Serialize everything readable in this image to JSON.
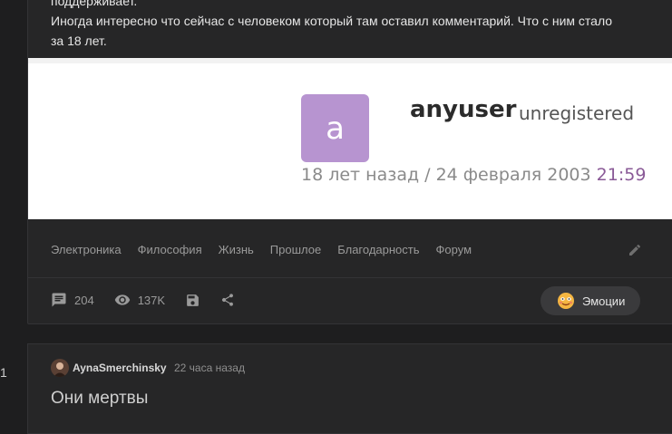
{
  "post": {
    "text_lines": [
      "поддерживает.",
      "Иногда интересно что сейчас с человеком который там оставил комментарий. Что с ним стало",
      "за 18 лет."
    ]
  },
  "embed": {
    "avatar_letter": "a",
    "username": "anyuser",
    "status": "unregistered",
    "date_prefix": "18 лет назад / 24 февраля 2003",
    "time": "21:59",
    "avatar_color": "#b794d0"
  },
  "tags": [
    "Электроника",
    "Философия",
    "Жизнь",
    "Прошлое",
    "Благодарность",
    "Форум"
  ],
  "stats": {
    "comments_count": "204",
    "views_count": "137K"
  },
  "emotions_button": {
    "label": "Эмоции"
  },
  "comment": {
    "author": "AynaSmerchinsky",
    "time": "22 часа назад",
    "text": "Они мертвы"
  },
  "side_marker": "1"
}
